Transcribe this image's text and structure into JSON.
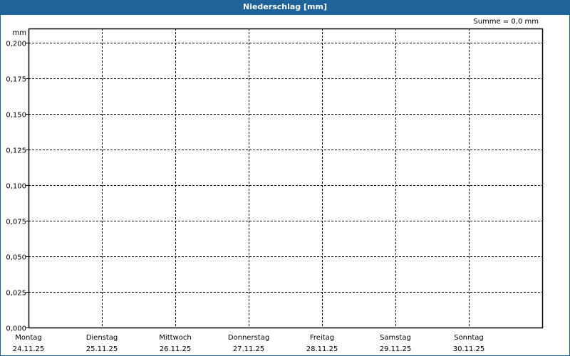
{
  "window": {
    "title": "Niederschlag [mm]",
    "accent": "#1e6399"
  },
  "summary": "Summe = 0,0 mm",
  "chart_data": {
    "type": "bar",
    "title": "Niederschlag [mm]",
    "ylabel": "mm",
    "ylim": [
      0,
      0.2
    ],
    "yticks": [
      "0,000",
      "0,025",
      "0,050",
      "0,075",
      "0,100",
      "0,125",
      "0,150",
      "0,175",
      "0,200"
    ],
    "categories": [
      {
        "day": "Montag",
        "date": "24.11.25"
      },
      {
        "day": "Dienstag",
        "date": "25.11.25"
      },
      {
        "day": "Mittwoch",
        "date": "26.11.25"
      },
      {
        "day": "Donnerstag",
        "date": "27.11.25"
      },
      {
        "day": "Freitag",
        "date": "28.11.25"
      },
      {
        "day": "Samstag",
        "date": "29.11.25"
      },
      {
        "day": "Sonntag",
        "date": "30.11.25"
      }
    ],
    "values": [],
    "grid": true
  }
}
